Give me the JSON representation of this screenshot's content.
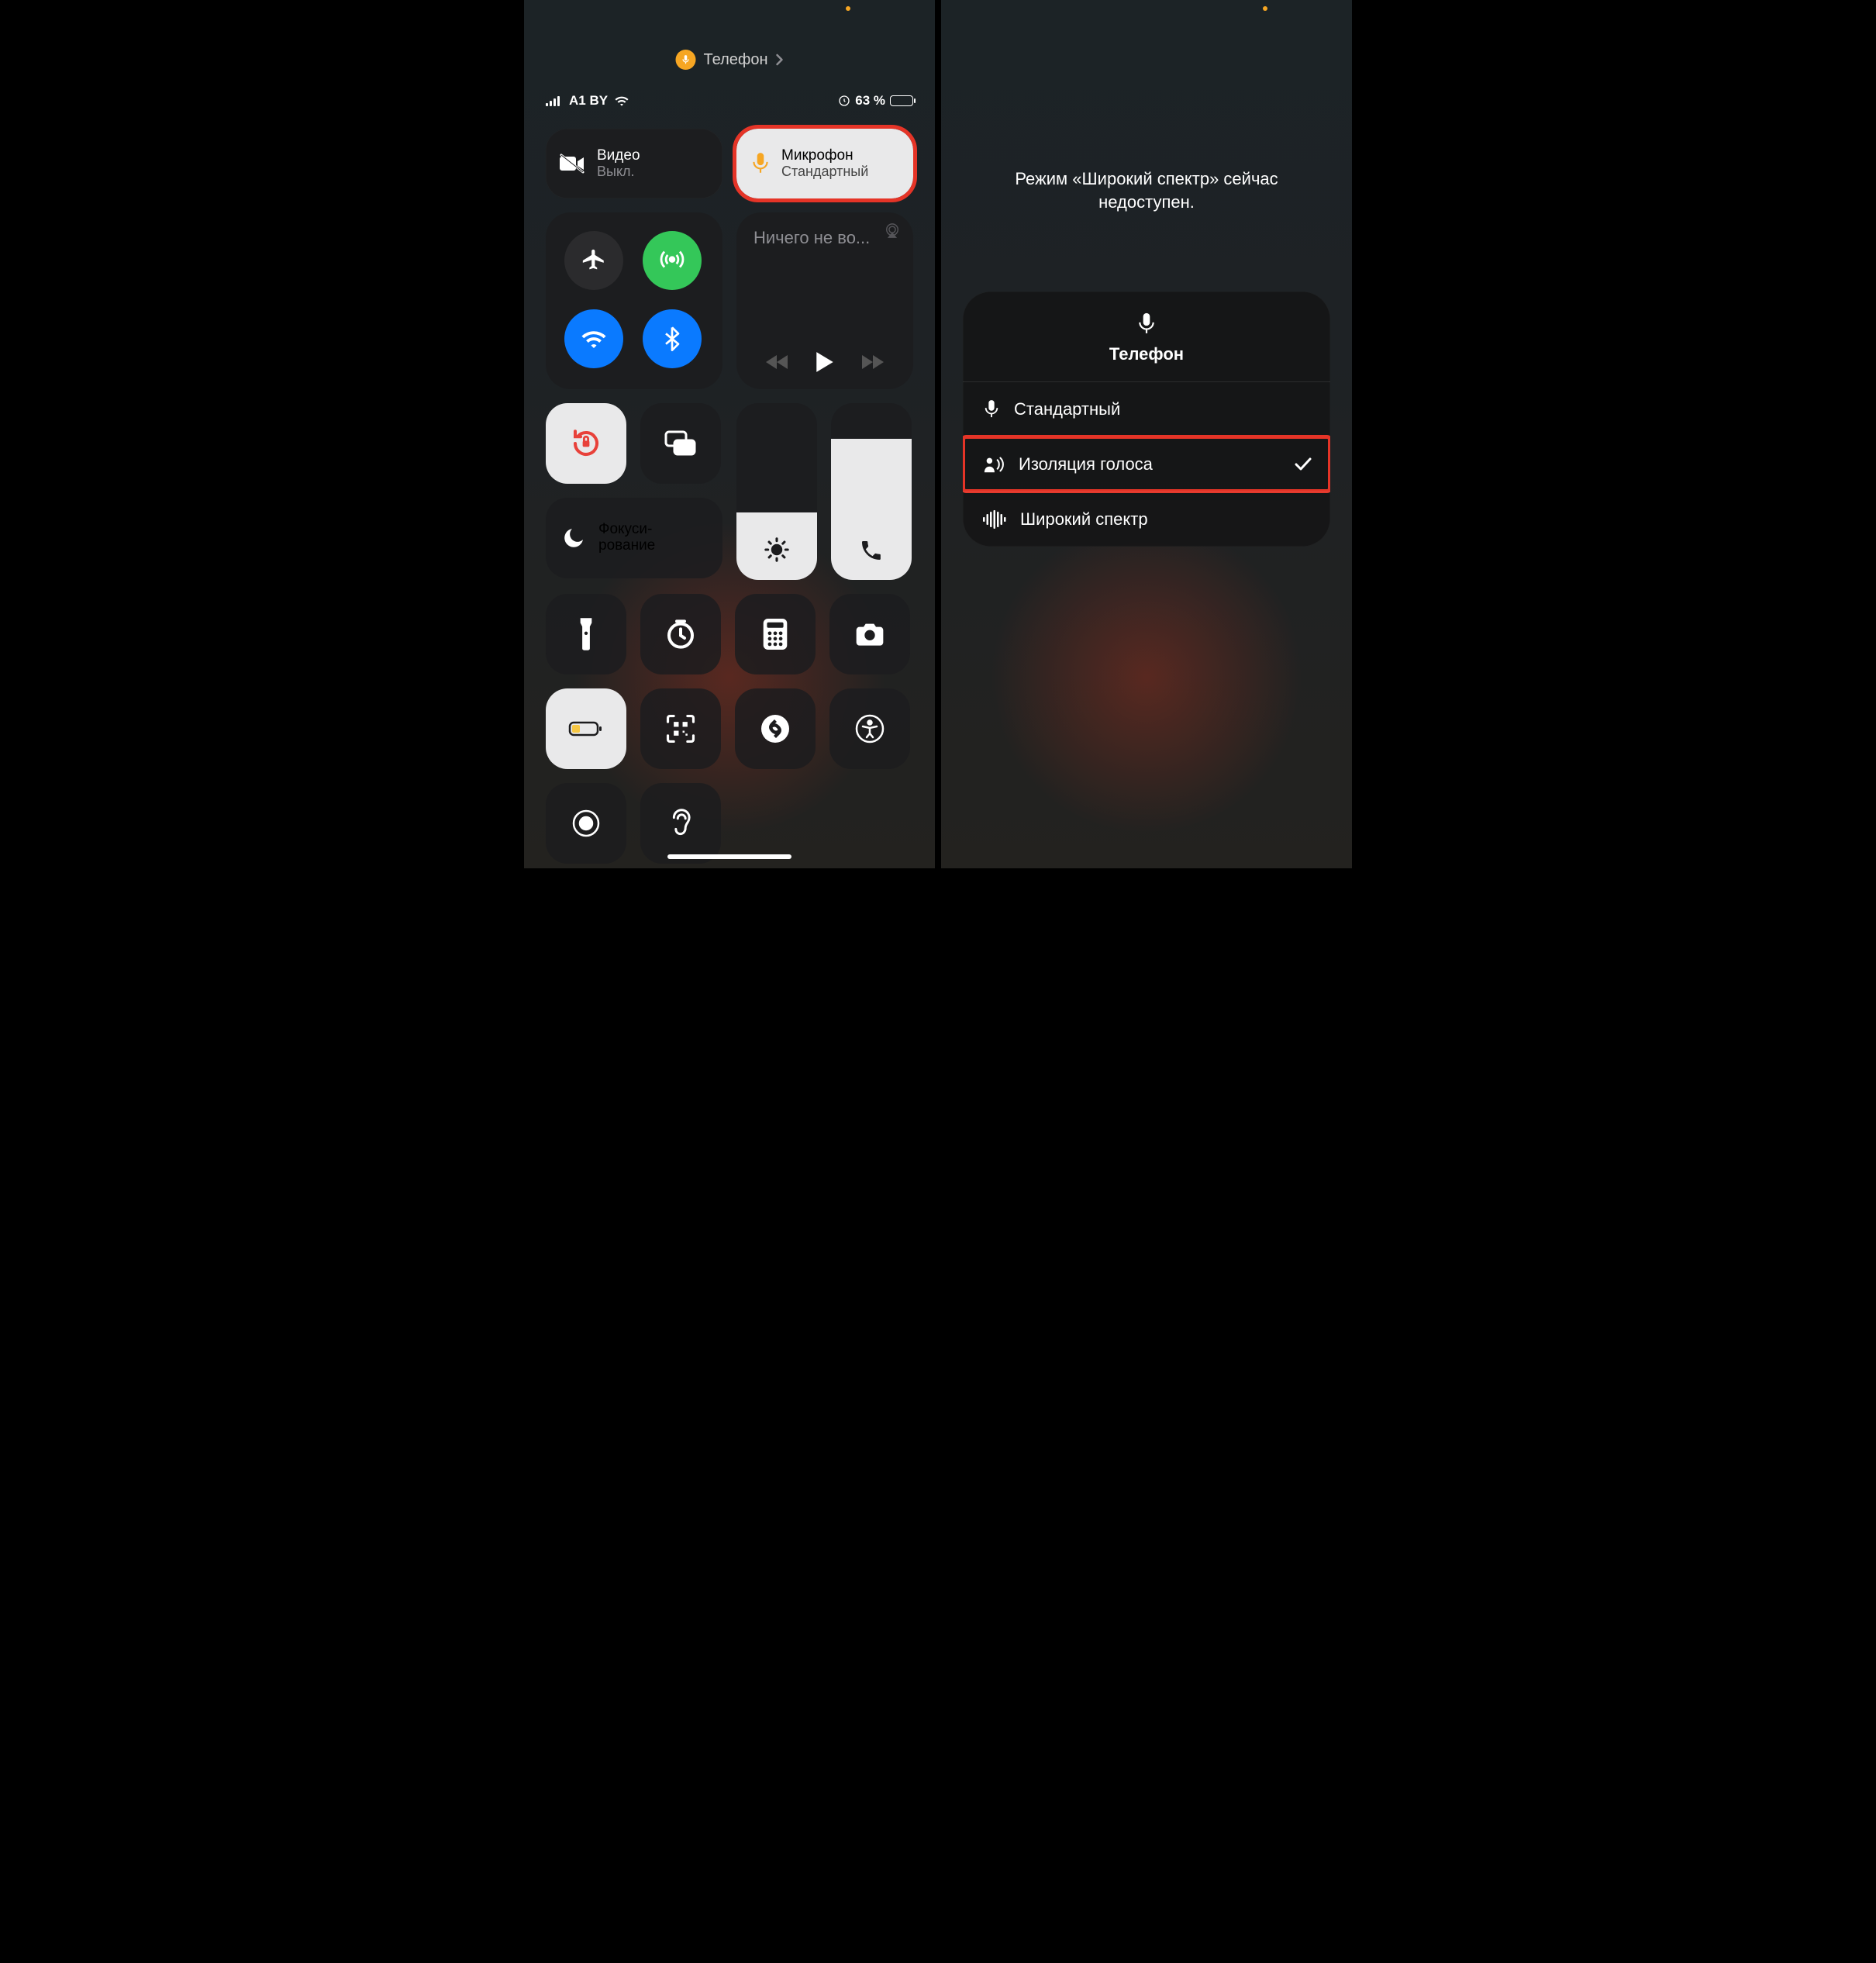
{
  "left": {
    "indicator_app": "Телефон",
    "status": {
      "carrier": "A1 BY",
      "battery_percent": "63 %"
    },
    "video": {
      "title": "Видео",
      "subtitle": "Выкл."
    },
    "mic": {
      "title": "Микрофон",
      "subtitle": "Стандартный"
    },
    "media": {
      "now_playing": "Ничего не во..."
    },
    "focus": {
      "label": "Фокуси-\nрование"
    }
  },
  "right": {
    "message": "Режим «Широкий спектр» сейчас недоступен.",
    "menu_title": "Телефон",
    "items": [
      {
        "label": "Стандартный",
        "selected": false
      },
      {
        "label": "Изоляция голоса",
        "selected": true
      },
      {
        "label": "Широкий спектр",
        "selected": false
      }
    ]
  }
}
